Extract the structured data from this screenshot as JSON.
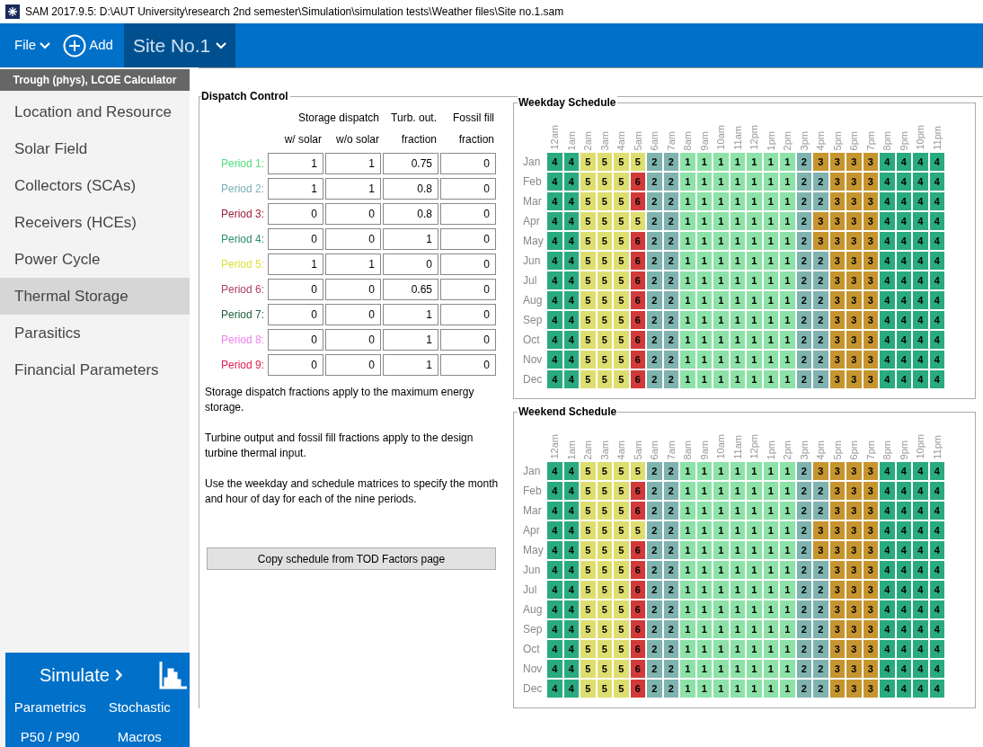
{
  "window": {
    "title": "SAM 2017.9.5: D:\\AUT University\\research 2nd semester\\Simulation\\simulation tests\\Weather files\\Site no.1.sam"
  },
  "toolbar": {
    "file": "File",
    "add": "Add",
    "case": "Site No.1"
  },
  "sidebar": {
    "header": "Trough (phys), LCOE Calculator",
    "items": [
      {
        "label": "Location and Resource",
        "selected": false
      },
      {
        "label": "Solar Field",
        "selected": false
      },
      {
        "label": "Collectors (SCAs)",
        "selected": false
      },
      {
        "label": "Receivers (HCEs)",
        "selected": false
      },
      {
        "label": "Power Cycle",
        "selected": false
      },
      {
        "label": "Thermal Storage",
        "selected": true
      },
      {
        "label": "Parasitics",
        "selected": false
      },
      {
        "label": "Financial Parameters",
        "selected": false
      }
    ],
    "simulate": "Simulate",
    "links": [
      "Parametrics",
      "Stochastic",
      "P50 / P90",
      "Macros"
    ]
  },
  "dispatch": {
    "title": "Dispatch Control",
    "header1": [
      "Storage dispatch",
      "Turb. out.",
      "Fossil fill"
    ],
    "header2": [
      "w/ solar",
      "w/o solar",
      "fraction",
      "fraction"
    ],
    "periods": [
      {
        "label": "Period 1:",
        "color": "#4ee07a",
        "values": [
          "1",
          "1",
          "0.75",
          "0"
        ]
      },
      {
        "label": "Period 2:",
        "color": "#7ab0b8",
        "values": [
          "1",
          "1",
          "0.8",
          "0"
        ]
      },
      {
        "label": "Period 3:",
        "color": "#a0203a",
        "values": [
          "0",
          "0",
          "0.8",
          "0"
        ]
      },
      {
        "label": "Period 4:",
        "color": "#2a9070",
        "values": [
          "0",
          "0",
          "1",
          "0"
        ]
      },
      {
        "label": "Period 5:",
        "color": "#e0e040",
        "values": [
          "1",
          "1",
          "0",
          "0"
        ]
      },
      {
        "label": "Period 6:",
        "color": "#b04060",
        "values": [
          "0",
          "0",
          "0.65",
          "0"
        ]
      },
      {
        "label": "Period 7:",
        "color": "#206040",
        "values": [
          "0",
          "0",
          "1",
          "0"
        ]
      },
      {
        "label": "Period 8:",
        "color": "#f080f0",
        "values": [
          "0",
          "0",
          "1",
          "0"
        ]
      },
      {
        "label": "Period 9:",
        "color": "#e02050",
        "values": [
          "0",
          "0",
          "1",
          "0"
        ]
      }
    ],
    "notes": [
      "Storage dispatch fractions apply to the maximum energy storage.",
      "Turbine output and fossil fill fractions apply to the design turbine thermal input.",
      "Use the weekday and schedule matrices to specify the month and hour of day for each of the nine periods."
    ],
    "copy_button": "Copy schedule from TOD Factors page"
  },
  "schedules": [
    {
      "title": "Weekday Schedule",
      "hours": [
        "12am",
        "1am",
        "2am",
        "3am",
        "4am",
        "5am",
        "6am",
        "7am",
        "8am",
        "9am",
        "10am",
        "11am",
        "12pm",
        "1pm",
        "2pm",
        "3pm",
        "4pm",
        "5pm",
        "6pm",
        "7pm",
        "8pm",
        "9pm",
        "10pm",
        "11pm"
      ],
      "rows": [
        {
          "month": "Jan",
          "values": [
            "4",
            "4",
            "5",
            "5",
            "5",
            "5",
            "2",
            "2",
            "1",
            "1",
            "1",
            "1",
            "1",
            "1",
            "1",
            "2",
            "3",
            "3",
            "3",
            "3",
            "4",
            "4",
            "4",
            "4"
          ]
        },
        {
          "month": "Feb",
          "values": [
            "4",
            "4",
            "5",
            "5",
            "5",
            "6",
            "2",
            "2",
            "1",
            "1",
            "1",
            "1",
            "1",
            "1",
            "1",
            "2",
            "2",
            "3",
            "3",
            "3",
            "4",
            "4",
            "4",
            "4"
          ]
        },
        {
          "month": "Mar",
          "values": [
            "4",
            "4",
            "5",
            "5",
            "5",
            "6",
            "2",
            "2",
            "1",
            "1",
            "1",
            "1",
            "1",
            "1",
            "1",
            "2",
            "2",
            "3",
            "3",
            "3",
            "4",
            "4",
            "4",
            "4"
          ]
        },
        {
          "month": "Apr",
          "values": [
            "4",
            "4",
            "5",
            "5",
            "5",
            "5",
            "2",
            "2",
            "1",
            "1",
            "1",
            "1",
            "1",
            "1",
            "1",
            "2",
            "3",
            "3",
            "3",
            "3",
            "4",
            "4",
            "4",
            "4"
          ]
        },
        {
          "month": "May",
          "values": [
            "4",
            "4",
            "5",
            "5",
            "5",
            "6",
            "2",
            "2",
            "1",
            "1",
            "1",
            "1",
            "1",
            "1",
            "1",
            "2",
            "3",
            "3",
            "3",
            "3",
            "4",
            "4",
            "4",
            "4"
          ]
        },
        {
          "month": "Jun",
          "values": [
            "4",
            "4",
            "5",
            "5",
            "5",
            "6",
            "2",
            "2",
            "1",
            "1",
            "1",
            "1",
            "1",
            "1",
            "1",
            "2",
            "2",
            "3",
            "3",
            "3",
            "4",
            "4",
            "4",
            "4"
          ]
        },
        {
          "month": "Jul",
          "values": [
            "4",
            "4",
            "5",
            "5",
            "5",
            "6",
            "2",
            "2",
            "1",
            "1",
            "1",
            "1",
            "1",
            "1",
            "1",
            "2",
            "2",
            "3",
            "3",
            "3",
            "4",
            "4",
            "4",
            "4"
          ]
        },
        {
          "month": "Aug",
          "values": [
            "4",
            "4",
            "5",
            "5",
            "5",
            "6",
            "2",
            "2",
            "1",
            "1",
            "1",
            "1",
            "1",
            "1",
            "1",
            "2",
            "2",
            "3",
            "3",
            "3",
            "4",
            "4",
            "4",
            "4"
          ]
        },
        {
          "month": "Sep",
          "values": [
            "4",
            "4",
            "5",
            "5",
            "5",
            "6",
            "2",
            "2",
            "1",
            "1",
            "1",
            "1",
            "1",
            "1",
            "1",
            "2",
            "2",
            "3",
            "3",
            "3",
            "4",
            "4",
            "4",
            "4"
          ]
        },
        {
          "month": "Oct",
          "values": [
            "4",
            "4",
            "5",
            "5",
            "5",
            "6",
            "2",
            "2",
            "1",
            "1",
            "1",
            "1",
            "1",
            "1",
            "1",
            "2",
            "2",
            "3",
            "3",
            "3",
            "4",
            "4",
            "4",
            "4"
          ]
        },
        {
          "month": "Nov",
          "values": [
            "4",
            "4",
            "5",
            "5",
            "5",
            "6",
            "2",
            "2",
            "1",
            "1",
            "1",
            "1",
            "1",
            "1",
            "1",
            "2",
            "2",
            "3",
            "3",
            "3",
            "4",
            "4",
            "4",
            "4"
          ]
        },
        {
          "month": "Dec",
          "values": [
            "4",
            "4",
            "5",
            "5",
            "5",
            "6",
            "2",
            "2",
            "1",
            "1",
            "1",
            "1",
            "1",
            "1",
            "1",
            "2",
            "2",
            "3",
            "3",
            "3",
            "4",
            "4",
            "4",
            "4"
          ]
        }
      ]
    },
    {
      "title": "Weekend Schedule",
      "hours": [
        "12am",
        "1am",
        "2am",
        "3am",
        "4am",
        "5am",
        "6am",
        "7am",
        "8am",
        "9am",
        "10am",
        "11am",
        "12pm",
        "1pm",
        "2pm",
        "3pm",
        "4pm",
        "5pm",
        "6pm",
        "7pm",
        "8pm",
        "9pm",
        "10pm",
        "11pm"
      ],
      "rows": [
        {
          "month": "Jan",
          "values": [
            "4",
            "4",
            "5",
            "5",
            "5",
            "5",
            "2",
            "2",
            "1",
            "1",
            "1",
            "1",
            "1",
            "1",
            "1",
            "2",
            "3",
            "3",
            "3",
            "3",
            "4",
            "4",
            "4",
            "4"
          ]
        },
        {
          "month": "Feb",
          "values": [
            "4",
            "4",
            "5",
            "5",
            "5",
            "6",
            "2",
            "2",
            "1",
            "1",
            "1",
            "1",
            "1",
            "1",
            "1",
            "2",
            "2",
            "3",
            "3",
            "3",
            "4",
            "4",
            "4",
            "4"
          ]
        },
        {
          "month": "Mar",
          "values": [
            "4",
            "4",
            "5",
            "5",
            "5",
            "6",
            "2",
            "2",
            "1",
            "1",
            "1",
            "1",
            "1",
            "1",
            "1",
            "2",
            "2",
            "3",
            "3",
            "3",
            "4",
            "4",
            "4",
            "4"
          ]
        },
        {
          "month": "Apr",
          "values": [
            "4",
            "4",
            "5",
            "5",
            "5",
            "5",
            "2",
            "2",
            "1",
            "1",
            "1",
            "1",
            "1",
            "1",
            "1",
            "2",
            "3",
            "3",
            "3",
            "3",
            "4",
            "4",
            "4",
            "4"
          ]
        },
        {
          "month": "May",
          "values": [
            "4",
            "4",
            "5",
            "5",
            "5",
            "6",
            "2",
            "2",
            "1",
            "1",
            "1",
            "1",
            "1",
            "1",
            "1",
            "2",
            "3",
            "3",
            "3",
            "3",
            "4",
            "4",
            "4",
            "4"
          ]
        },
        {
          "month": "Jun",
          "values": [
            "4",
            "4",
            "5",
            "5",
            "5",
            "6",
            "2",
            "2",
            "1",
            "1",
            "1",
            "1",
            "1",
            "1",
            "1",
            "2",
            "2",
            "3",
            "3",
            "3",
            "4",
            "4",
            "4",
            "4"
          ]
        },
        {
          "month": "Jul",
          "values": [
            "4",
            "4",
            "5",
            "5",
            "5",
            "6",
            "2",
            "2",
            "1",
            "1",
            "1",
            "1",
            "1",
            "1",
            "1",
            "2",
            "2",
            "3",
            "3",
            "3",
            "4",
            "4",
            "4",
            "4"
          ]
        },
        {
          "month": "Aug",
          "values": [
            "4",
            "4",
            "5",
            "5",
            "5",
            "6",
            "2",
            "2",
            "1",
            "1",
            "1",
            "1",
            "1",
            "1",
            "1",
            "2",
            "2",
            "3",
            "3",
            "3",
            "4",
            "4",
            "4",
            "4"
          ]
        },
        {
          "month": "Sep",
          "values": [
            "4",
            "4",
            "5",
            "5",
            "5",
            "6",
            "2",
            "2",
            "1",
            "1",
            "1",
            "1",
            "1",
            "1",
            "1",
            "2",
            "2",
            "3",
            "3",
            "3",
            "4",
            "4",
            "4",
            "4"
          ]
        },
        {
          "month": "Oct",
          "values": [
            "4",
            "4",
            "5",
            "5",
            "5",
            "6",
            "2",
            "2",
            "1",
            "1",
            "1",
            "1",
            "1",
            "1",
            "1",
            "2",
            "2",
            "3",
            "3",
            "3",
            "4",
            "4",
            "4",
            "4"
          ]
        },
        {
          "month": "Nov",
          "values": [
            "4",
            "4",
            "5",
            "5",
            "5",
            "6",
            "2",
            "2",
            "1",
            "1",
            "1",
            "1",
            "1",
            "1",
            "1",
            "2",
            "2",
            "3",
            "3",
            "3",
            "4",
            "4",
            "4",
            "4"
          ]
        },
        {
          "month": "Dec",
          "values": [
            "4",
            "4",
            "5",
            "5",
            "5",
            "6",
            "2",
            "2",
            "1",
            "1",
            "1",
            "1",
            "1",
            "1",
            "1",
            "2",
            "2",
            "3",
            "3",
            "3",
            "4",
            "4",
            "4",
            "4"
          ]
        }
      ]
    }
  ]
}
